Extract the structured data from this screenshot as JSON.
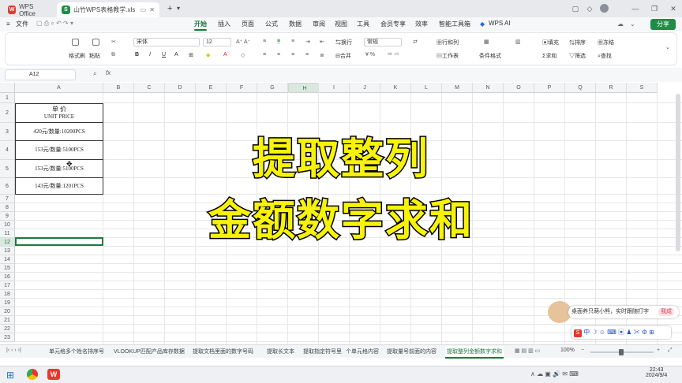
{
  "titlebar": {
    "tabs": [
      {
        "label": "WPS Office",
        "icon": "wps-logo-icon"
      },
      {
        "label": "山竹WPS表格教学.xls",
        "icon": "spreadsheet-s-icon"
      }
    ],
    "new_tab": "+",
    "menu_arrow": "▾"
  },
  "menubar": {
    "file": "文件",
    "items": [
      "开始",
      "插入",
      "页面",
      "公式",
      "数据",
      "审阅",
      "视图",
      "工具",
      "会员专享",
      "效率",
      "智能工具箱"
    ],
    "active": "开始",
    "wps_ai": "WPS AI",
    "share": "分享"
  },
  "ribbon": {
    "format_painter": "格式刷",
    "paste": "粘贴",
    "font_name": "宋体",
    "font_size": "12",
    "wrap": "换行",
    "merge": "合并",
    "number_format": "常规",
    "convert": "转换",
    "row_col": "行和列",
    "worksheet": "工作表",
    "cond_format": "条件格式",
    "fill": "填充",
    "sort": "排序",
    "filter": "筛选",
    "sum": "求和",
    "freeze": "冻结",
    "find": "查找"
  },
  "formula": {
    "name_box": "A12",
    "fx": "fx"
  },
  "columns": [
    "A",
    "B",
    "C",
    "D",
    "E",
    "F",
    "G",
    "H",
    "I",
    "J",
    "K",
    "L",
    "M",
    "N",
    "O",
    "P",
    "Q",
    "R",
    "S"
  ],
  "selected_column": "H",
  "rows": [
    "1",
    "2",
    "3",
    "4",
    "5",
    "6",
    "7",
    "8",
    "9",
    "10",
    "11",
    "12",
    "13",
    "14",
    "15",
    "16",
    "17",
    "18",
    "19",
    "20",
    "21",
    "22",
    "23"
  ],
  "selected_row": "12",
  "cells": {
    "header_cn": "单  价",
    "header_en": "UNIT PRICE",
    "r3": "420元/数量:10200PCS",
    "r4": "153元/数量:5100PCS",
    "r5": "153元/数量:5100PCS",
    "r6": "143元/数量:1201PCS"
  },
  "overlay": {
    "line1": "提取整列",
    "line2": "金额数字求和"
  },
  "sheets": [
    "单元格多个姓名排序号",
    "VLOOKUP匹配产品库存数据",
    "提取文档里面的数字号码",
    "提取长文本",
    "提取指定符号里",
    "个单元格内容",
    "提取量号前面的内容",
    "提取整列金额数字求和"
  ],
  "active_sheet": "提取整列金额数字求和",
  "status": {
    "zoom": "100%"
  },
  "ime_popup": {
    "text": "桌面养只萌小熊，实时跟随打字",
    "button": "我成"
  },
  "taskbar": {
    "time": "22:43",
    "date": "2024/9/4"
  },
  "colors": {
    "accent": "#1b7a3e",
    "overlay_text": "#f7f20a"
  }
}
